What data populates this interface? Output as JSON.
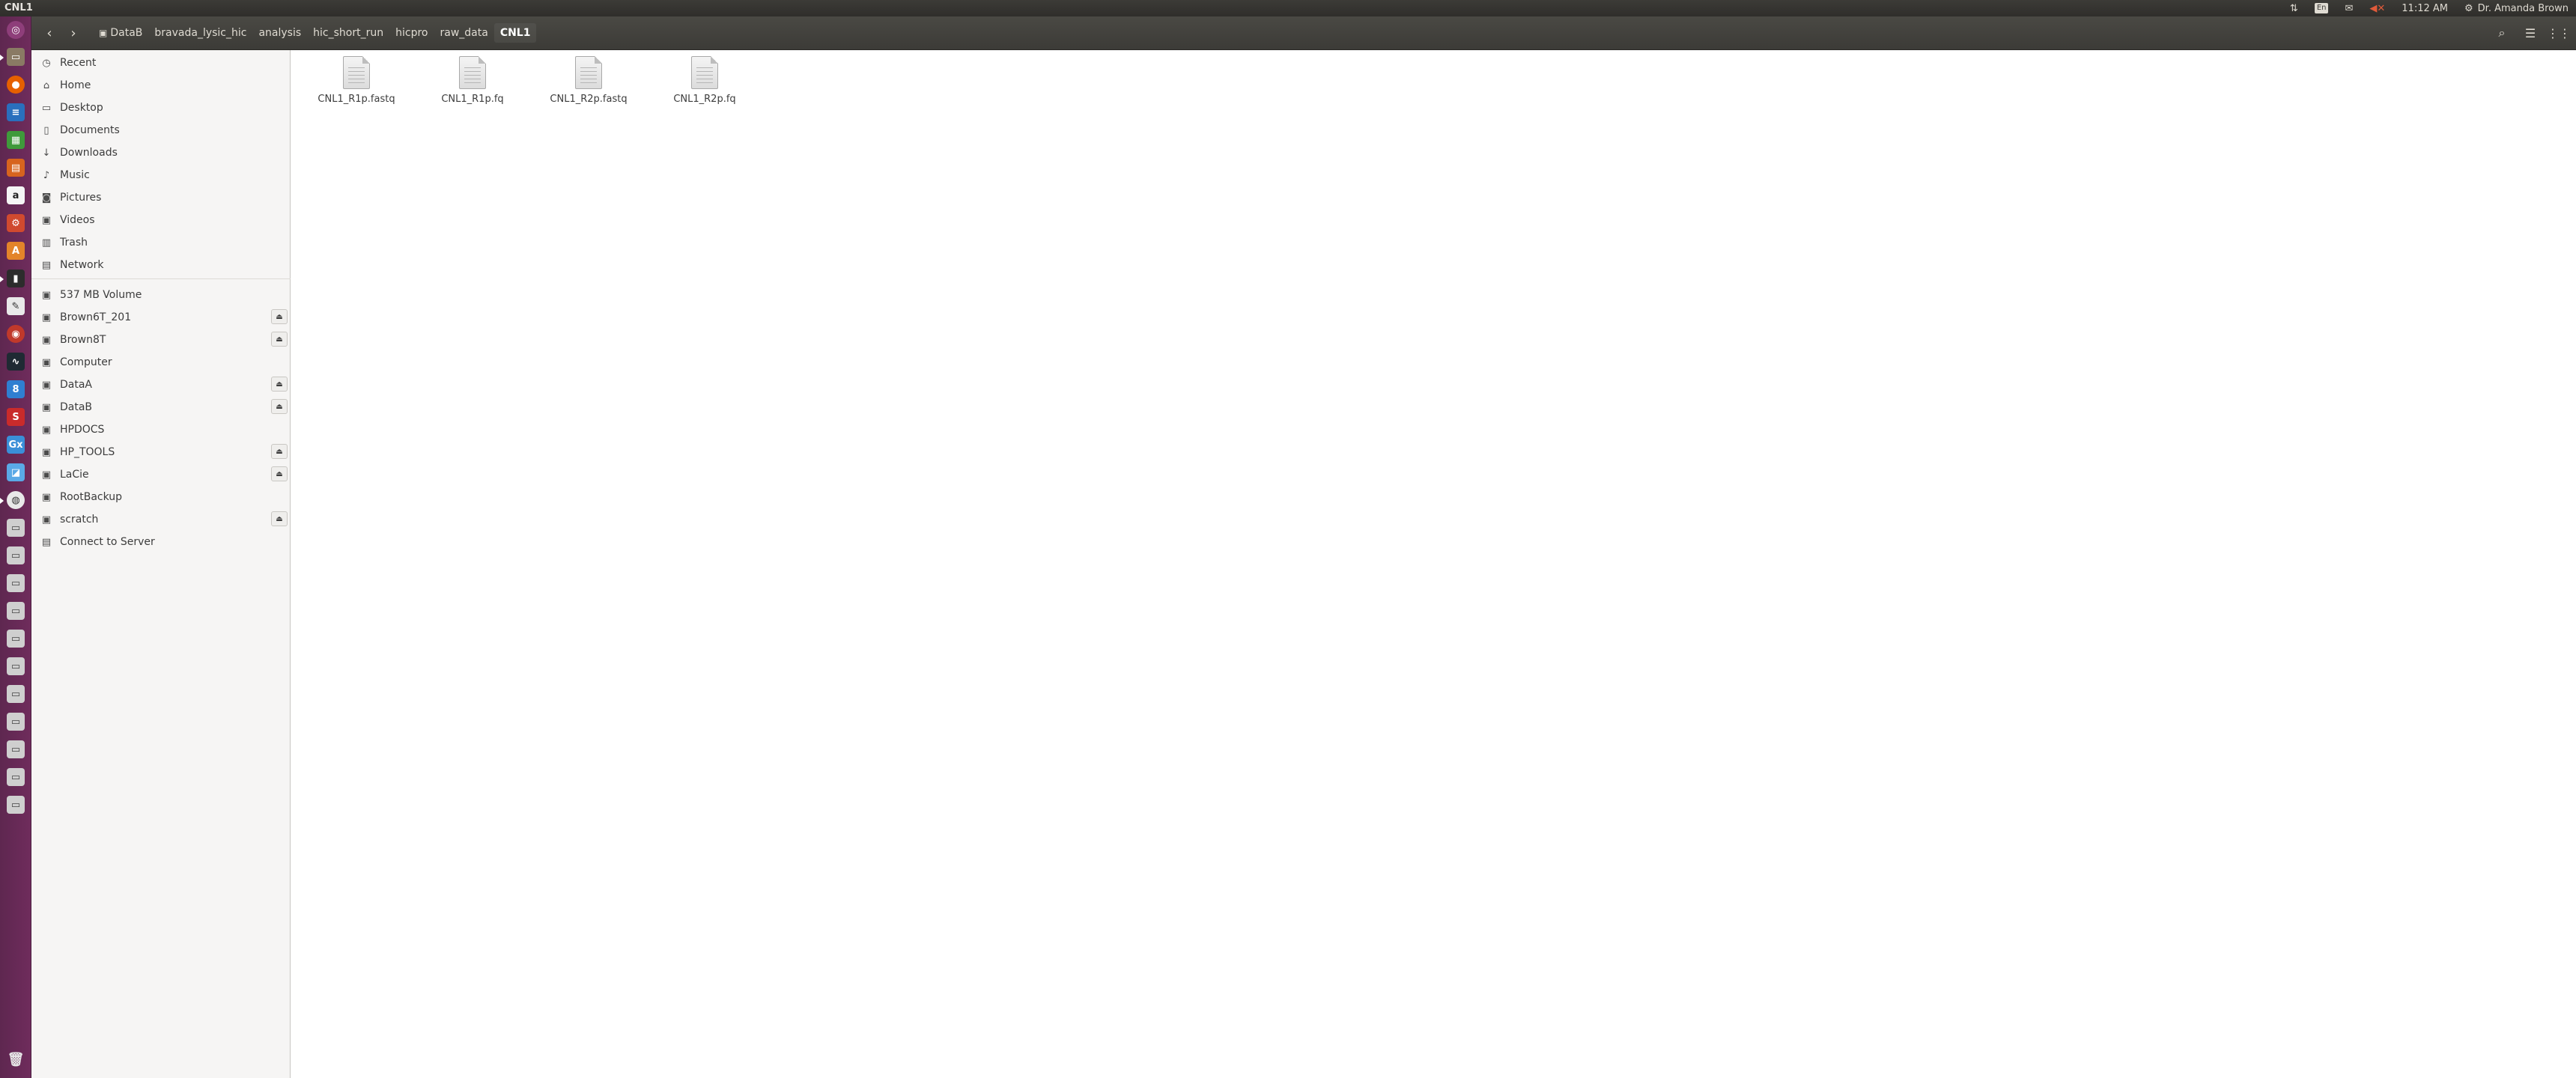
{
  "window": {
    "title": "CNL1"
  },
  "panel": {
    "time": "11:12 AM",
    "user": "Dr. Amanda Brown",
    "keyboard": "En"
  },
  "toolbar": {
    "breadcrumbs": [
      "DataB",
      "bravada_lysic_hic",
      "analysis",
      "hic_short_run",
      "hicpro",
      "raw_data",
      "CNL1"
    ]
  },
  "sidebar": {
    "places": [
      "Recent",
      "Home",
      "Desktop",
      "Documents",
      "Downloads",
      "Music",
      "Pictures",
      "Videos",
      "Trash",
      "Network"
    ],
    "devices": [
      "537 MB Volume",
      "Brown6T_201",
      "Brown8T",
      "Computer",
      "DataA",
      "DataB",
      "HPDOCS",
      "HP_TOOLS",
      "LaCie",
      "RootBackup",
      "scratch",
      "Connect to Server"
    ]
  },
  "files": [
    "CNL1_R1p.fastq",
    "CNL1_R1p.fq",
    "CNL1_R2p.fastq",
    "CNL1_R2p.fq"
  ],
  "colors": {
    "launcher": "#6f2c5c",
    "panel": "#3c3b37",
    "accent": "#e95420"
  }
}
